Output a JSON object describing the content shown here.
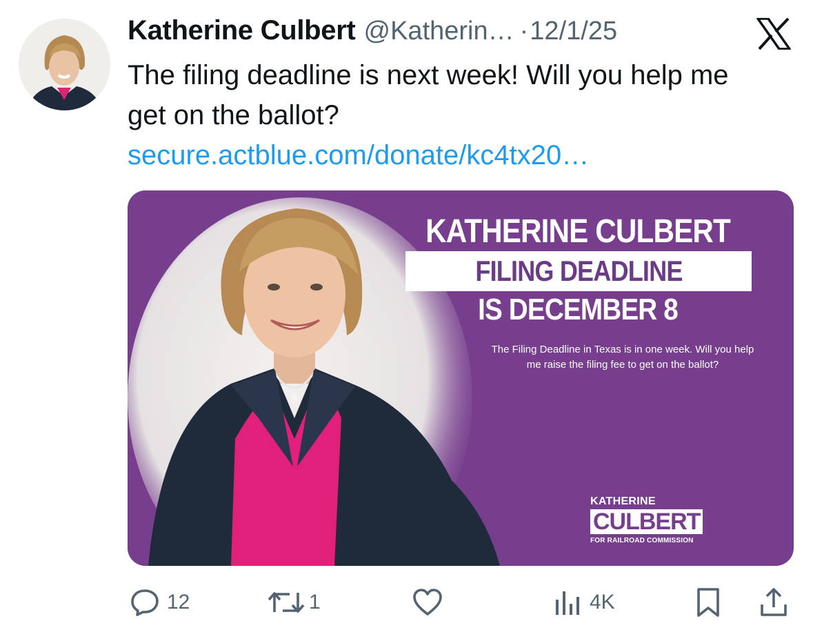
{
  "author": {
    "name": "Katherine Culbert",
    "handle": "@Katherin…",
    "separator": "·",
    "date": "12/1/25"
  },
  "platform_icon": "x-logo-icon",
  "tweet": {
    "text": "The filing deadline is next week! Will you help me get on the ballot?",
    "link": "secure.actblue.com/donate/kc4tx20…"
  },
  "media": {
    "headline": "KATHERINE CULBERT",
    "deadline_label": "FILING DEADLINE",
    "date_line": "IS DECEMBER 8",
    "body": "The Filing Deadline in Texas is in one week. Will you help me raise the filing fee to get on the ballot?",
    "brand_first": "KATHERINE",
    "brand_last": "CULBERT",
    "brand_sub": "FOR RAILROAD COMMISSION",
    "background_color": "#773e8d"
  },
  "actions": {
    "replies": "12",
    "reposts": "1",
    "views": "4K",
    "icons": [
      "reply-icon",
      "repost-icon",
      "like-icon",
      "views-icon",
      "bookmark-icon",
      "share-icon"
    ]
  },
  "colors": {
    "text": "#0f1419",
    "muted": "#536471",
    "link": "#1d9bf0"
  }
}
